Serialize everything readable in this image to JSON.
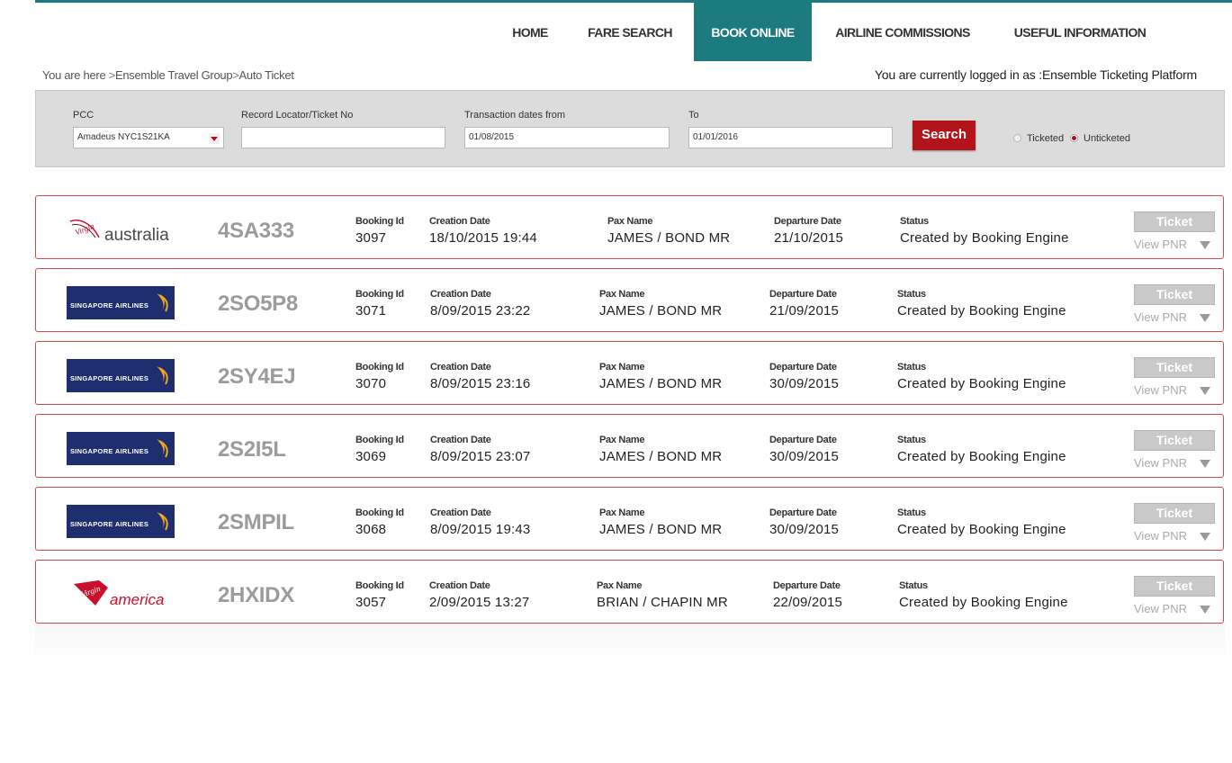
{
  "nav": {
    "items": [
      {
        "label": "HOME",
        "active": false
      },
      {
        "label": "FARE SEARCH",
        "active": false
      },
      {
        "label": "BOOK ONLINE",
        "active": true
      },
      {
        "label": "AIRLINE COMMISSIONS",
        "active": false
      },
      {
        "label": "USEFUL INFORMATION",
        "active": false
      }
    ]
  },
  "breadcrumb": {
    "prefix": "You are here",
    "items": [
      "Ensemble Travel Group",
      "Auto Ticket"
    ],
    "separator": ">"
  },
  "logged_in": "You are currently logged in as :Ensemble Ticketing Platform",
  "search": {
    "pcc_label": "PCC",
    "pcc_value": "Amadeus NYC1S21KA",
    "locator_label": "Record Locator/Ticket No",
    "locator_value": "",
    "from_label": "Transaction dates from",
    "from_value": "01/08/2015",
    "to_label": "To",
    "to_value": "01/01/2016",
    "button_label": "Search",
    "radio_ticketed": "Ticketed",
    "radio_unticketed": "Unticketed",
    "selected": "Unticketed"
  },
  "labels": {
    "booking_id": "Booking Id",
    "creation_date": "Creation Date",
    "pax_name": "Pax Name",
    "departure_date": "Departure Date",
    "status": "Status",
    "ticket_button": "Ticket",
    "view_pnr": "View PNR"
  },
  "logos": {
    "virgin_australia": {
      "script": "Virgin",
      "word": "australia"
    },
    "singapore": {
      "text": "SINGAPORE AIRLINES"
    },
    "virgin_america": {
      "script": "Virgin",
      "word": "america"
    }
  },
  "bookings": [
    {
      "airline": "virgin_australia",
      "ref": "4SA333",
      "booking_id": "3097",
      "creation_date": "18/10/2015 19:44",
      "pax_name": "JAMES / BOND MR",
      "departure_date": "21/10/2015",
      "status": "Created by Booking Engine"
    },
    {
      "airline": "singapore",
      "ref": "2SO5P8",
      "booking_id": "3071",
      "creation_date": "8/09/2015 23:22",
      "pax_name": "JAMES / BOND MR",
      "departure_date": "21/09/2015",
      "status": "Created by Booking Engine"
    },
    {
      "airline": "singapore",
      "ref": "2SY4EJ",
      "booking_id": "3070",
      "creation_date": "8/09/2015 23:16",
      "pax_name": "JAMES / BOND MR",
      "departure_date": "30/09/2015",
      "status": "Created by Booking Engine"
    },
    {
      "airline": "singapore",
      "ref": "2S2I5L",
      "booking_id": "3069",
      "creation_date": "8/09/2015 23:07",
      "pax_name": "JAMES / BOND MR",
      "departure_date": "30/09/2015",
      "status": "Created by Booking Engine"
    },
    {
      "airline": "singapore",
      "ref": "2SMPIL",
      "booking_id": "3068",
      "creation_date": "8/09/2015 19:43",
      "pax_name": "JAMES / BOND MR",
      "departure_date": "30/09/2015",
      "status": "Created by Booking Engine"
    },
    {
      "airline": "virgin_america",
      "ref": "2HXIDX",
      "booking_id": "3057",
      "creation_date": "2/09/2015 13:27",
      "pax_name": "BRIAN / CHAPIN MR",
      "departure_date": "22/09/2015",
      "status": "Created by Booking Engine"
    }
  ],
  "colors": {
    "accent": "#1b7b7e",
    "brand_red": "#b3141b",
    "row_border": "#d44a4f",
    "singapore_blue": "#1f2e6e"
  }
}
